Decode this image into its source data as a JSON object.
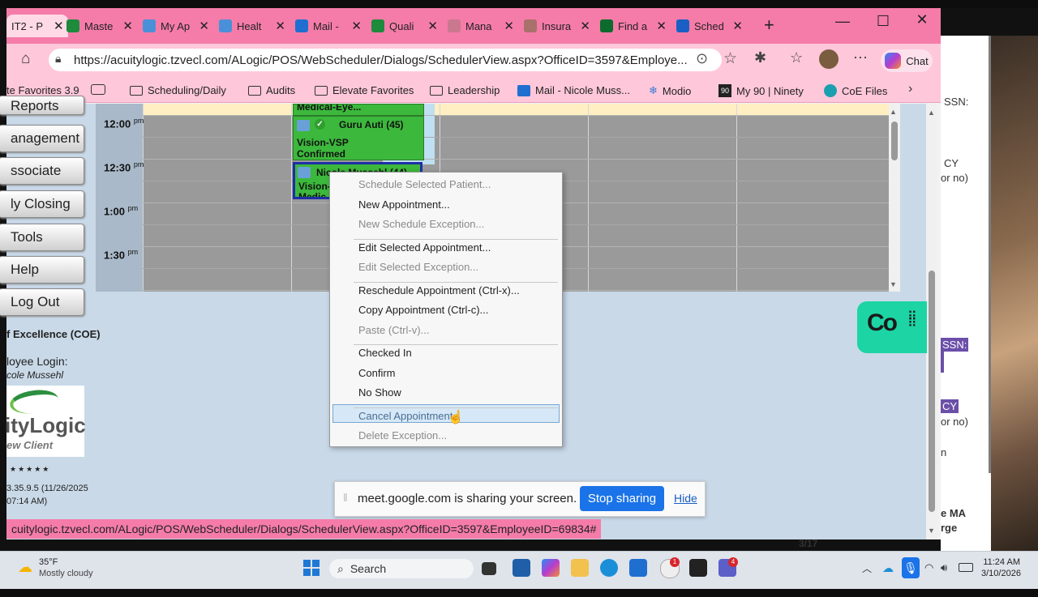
{
  "tabs": [
    {
      "label": "IT2 - P",
      "color": "#1e6bd6",
      "active": true
    },
    {
      "label": "Maste",
      "color": "#1e8a3c"
    },
    {
      "label": "My Ap",
      "color": "#4a90d9"
    },
    {
      "label": "Healt",
      "color": "#4a90d9"
    },
    {
      "label": "Mail -",
      "color": "#1f6fd1"
    },
    {
      "label": "Quali",
      "color": "#1e8a3c"
    },
    {
      "label": "Mana",
      "color": "#c9788f"
    },
    {
      "label": "Insura",
      "color": "#a8716b"
    },
    {
      "label": "Find a",
      "color": "#0c6b2d"
    },
    {
      "label": "Sched",
      "color": "#1a5fc4"
    }
  ],
  "address": {
    "url": "https://acuitylogic.tzvecl.com/ALogic/POS/WebScheduler/Dialogs/SchedulerView.aspx?OfficeID=3597&Employe..."
  },
  "chat_label": "Chat",
  "favorites": [
    {
      "label": "te Favorites 3.9",
      "icon": "none"
    },
    {
      "label": "",
      "icon": "card"
    },
    {
      "label": "Scheduling/Daily",
      "icon": "folder"
    },
    {
      "label": "Audits",
      "icon": "folder"
    },
    {
      "label": "Elevate Favorites",
      "icon": "folder"
    },
    {
      "label": "Leadership",
      "icon": "folder"
    },
    {
      "label": "Mail - Nicole Muss...",
      "icon": "mail"
    },
    {
      "label": "Modio",
      "icon": "snow"
    },
    {
      "label": "My 90 | Ninety",
      "icon": "ninety"
    },
    {
      "label": "CoE Files",
      "icon": "coe"
    }
  ],
  "leftnav": {
    "buttons": [
      "Reports",
      "anagement",
      "ssociate",
      "ly Closing",
      "Tools",
      "Help",
      "Log Out"
    ],
    "coe": "f Excellence (COE)",
    "login_label": "loyee Login:",
    "login_name": "cole Mussehl",
    "logo_text": "ityLogic",
    "logo_sub": "ew Client",
    "stars": "★★★★★",
    "version": "3.35.9.5 (11/26/2025",
    "version2": "07:14 AM)"
  },
  "schedule": {
    "times": [
      {
        "hour": "12:00",
        "ampm": "pm"
      },
      {
        "hour": "12:30",
        "ampm": "pm"
      },
      {
        "hour": "1:00",
        "ampm": "pm"
      },
      {
        "hour": "1:30",
        "ampm": "pm"
      }
    ],
    "top_appt": "Medical-Eye...",
    "appt1": {
      "name": "Guru Auti (45)",
      "type": "Vision-VSP",
      "status": "Confirmed"
    },
    "appt2": {
      "name": "Nicole Mussehl (44)",
      "type": "Vision-",
      "type2": "Medic"
    }
  },
  "context_menu": {
    "groups": [
      [
        {
          "label": "Schedule Selected Patient...",
          "disabled": true
        },
        {
          "label": "New Appointment...",
          "disabled": false
        },
        {
          "label": "New Schedule Exception...",
          "disabled": true
        }
      ],
      [
        {
          "label": "Edit Selected Appointment...",
          "disabled": false
        },
        {
          "label": "Edit Selected Exception...",
          "disabled": true
        }
      ],
      [
        {
          "label": "Reschedule Appointment (Ctrl-x)...",
          "disabled": false
        },
        {
          "label": "Copy Appointment (Ctrl-c)...",
          "disabled": false
        },
        {
          "label": "Paste (Ctrl-v)...",
          "disabled": true
        }
      ],
      [
        {
          "label": "Checked In",
          "disabled": false
        },
        {
          "label": "Confirm",
          "disabled": false
        },
        {
          "label": "No Show",
          "disabled": false
        }
      ],
      [
        {
          "label": "Cancel Appointment",
          "disabled": false,
          "hover": true
        },
        {
          "label": "Delete Exception...",
          "disabled": true
        }
      ]
    ]
  },
  "cowidget": {
    "label": "Co"
  },
  "sharebar": {
    "text": "meet.google.com is sharing your screen.",
    "stop": "Stop sharing",
    "hide": "Hide"
  },
  "status_url": "cuitylogic.tzvecl.com/ALogic/POS/WebScheduler/Dialogs/SchedulerView.aspx?OfficeID=3597&EmployeeID=69834#",
  "bgwindow": {
    "l1": "SSN:",
    "l2": "CY",
    "l3": "or no)",
    "l4": "SSN:",
    "l5": "CY",
    "l6": "or no)",
    "l7": "n",
    "l8": "e MA",
    "l9": "rge",
    "l10": "3/17"
  },
  "taskbar": {
    "weather_temp": "35°F",
    "weather_desc": "Mostly cloudy",
    "search": "Search",
    "time": "11:24 AM",
    "date": "3/10/2026",
    "badge1": "1",
    "badge2": "4"
  }
}
